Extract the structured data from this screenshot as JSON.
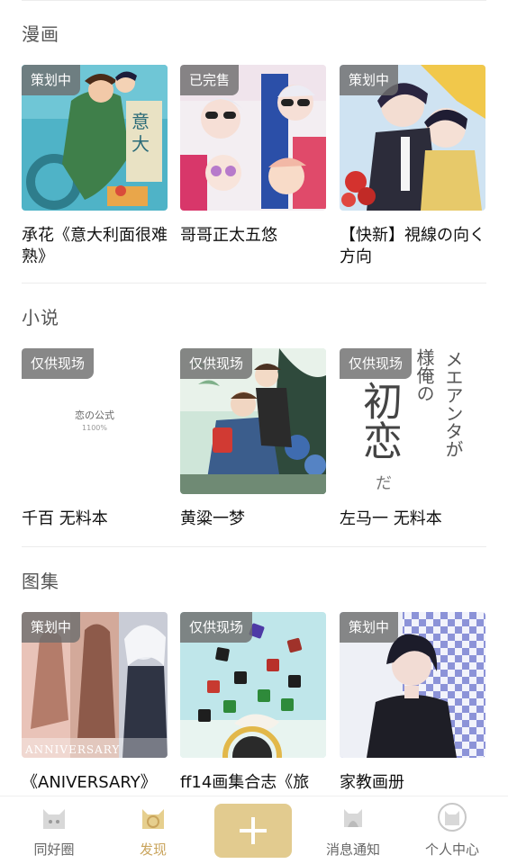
{
  "sections": [
    {
      "title": "漫画",
      "items": [
        {
          "badge": "策划中",
          "title": "承花《意大利面很难熟》"
        },
        {
          "badge": "已完售",
          "title": "哥哥正太五悠"
        },
        {
          "badge": "策划中",
          "title": "【快新】視線の向く方向"
        }
      ]
    },
    {
      "title": "小说",
      "items": [
        {
          "badge": "仅供现场",
          "title": "千百 无料本",
          "cover_text": "恋の公式",
          "cover_subtext": "1100%"
        },
        {
          "badge": "仅供现场",
          "title": "黄粱一梦"
        },
        {
          "badge": "仅供现场",
          "title": "左马一 无料本",
          "cover_big": "初恋",
          "cover_side1": "メエアンタが",
          "cover_side2": "様俺の",
          "cover_small": "だ"
        }
      ]
    },
    {
      "title": "图集",
      "items": [
        {
          "badge": "策划中",
          "title": "《ANIVERSARY》",
          "cover_text": "ANNIVERSARY"
        },
        {
          "badge": "仅供现场",
          "title": "ff14画集合志《旅"
        },
        {
          "badge": "策划中",
          "title": "家教画册"
        }
      ]
    }
  ],
  "bottom_nav": {
    "items": [
      {
        "label": "同好圈",
        "icon": "cat-community-icon"
      },
      {
        "label": "发现",
        "icon": "cat-discover-icon",
        "active": true
      },
      {
        "label": "",
        "icon": "plus-icon"
      },
      {
        "label": "消息通知",
        "icon": "bell-cat-icon"
      },
      {
        "label": "个人中心",
        "icon": "profile-cat-icon"
      }
    ]
  },
  "colors": {
    "accent": "#e2cb8f",
    "accent_text": "#c9a45c",
    "badge_bg": "#6e6e6e"
  }
}
